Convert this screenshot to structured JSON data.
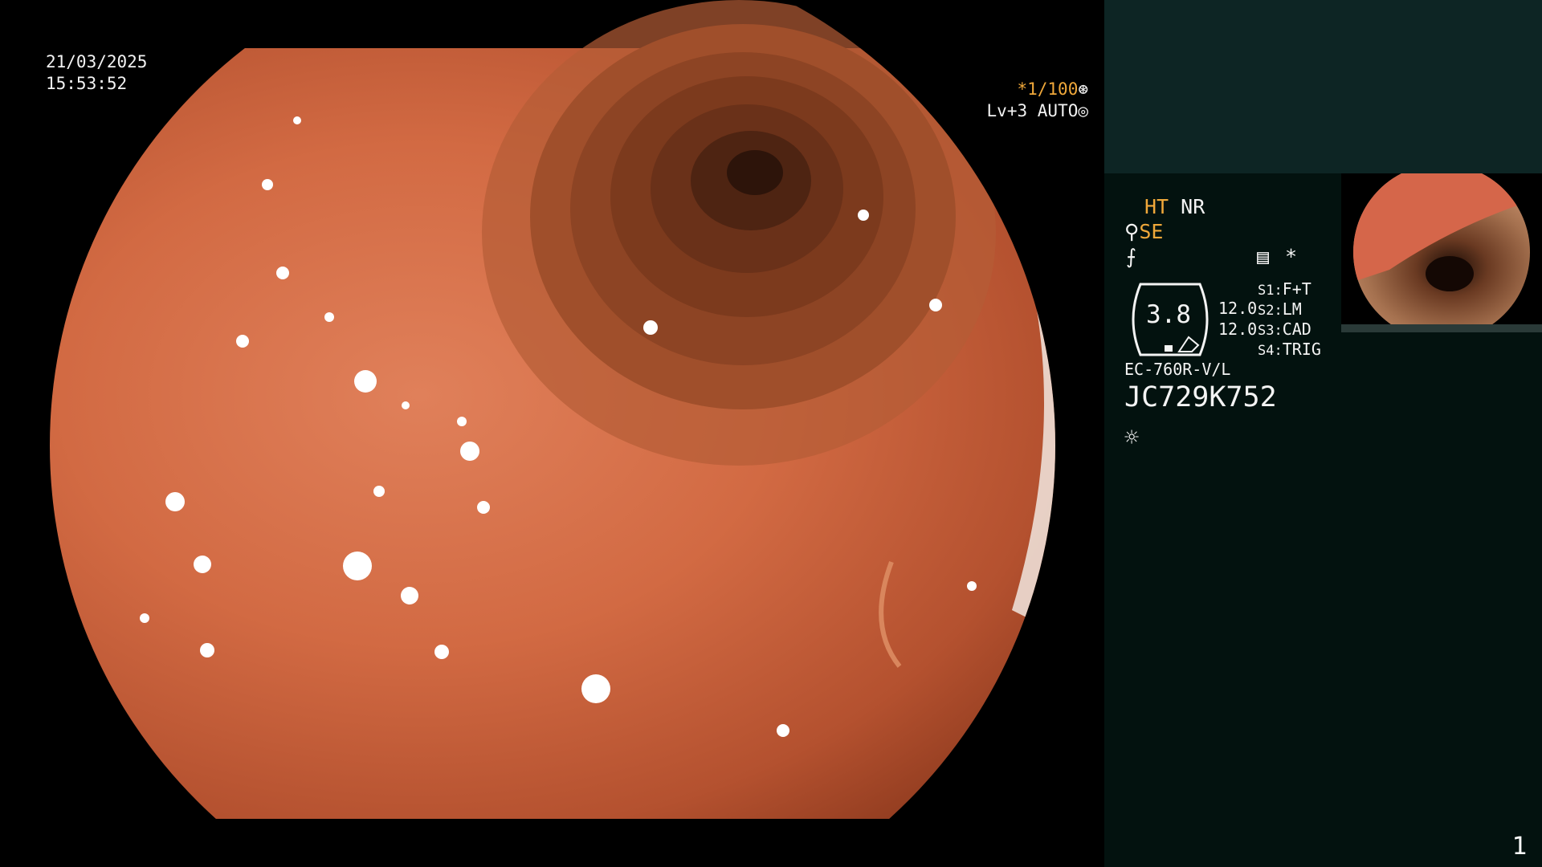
{
  "osd": {
    "date": "21/03/2025",
    "time": "15:53:52",
    "shutter": "*1/100",
    "level": "Lv+3",
    "auto": "AUTO"
  },
  "panel": {
    "ht": "HT",
    "nr": "NR",
    "se": "SE",
    "gauge_value": "3.8",
    "value_a": "12.0",
    "value_b": "12.0",
    "s1_key": "S1:",
    "s1_val": "F+T",
    "s2_key": "S2:",
    "s2_val": "LM",
    "s3_key": "S3:",
    "s3_val": "CAD",
    "s4_key": "S4:",
    "s4_val": "TRIG",
    "scope_model": "EC-760R-V/L",
    "scope_serial": "JC729K752",
    "page_number": "1"
  },
  "colors": {
    "orange_indicator": "#f0a83a",
    "panel_background": "#03120f",
    "panel_top": "#0d2524"
  },
  "icons": [
    "shutter-icon",
    "auto-iris-icon",
    "scope-icon",
    "freeze-icon",
    "memory-icon",
    "asterisk-icon",
    "light-icon"
  ]
}
